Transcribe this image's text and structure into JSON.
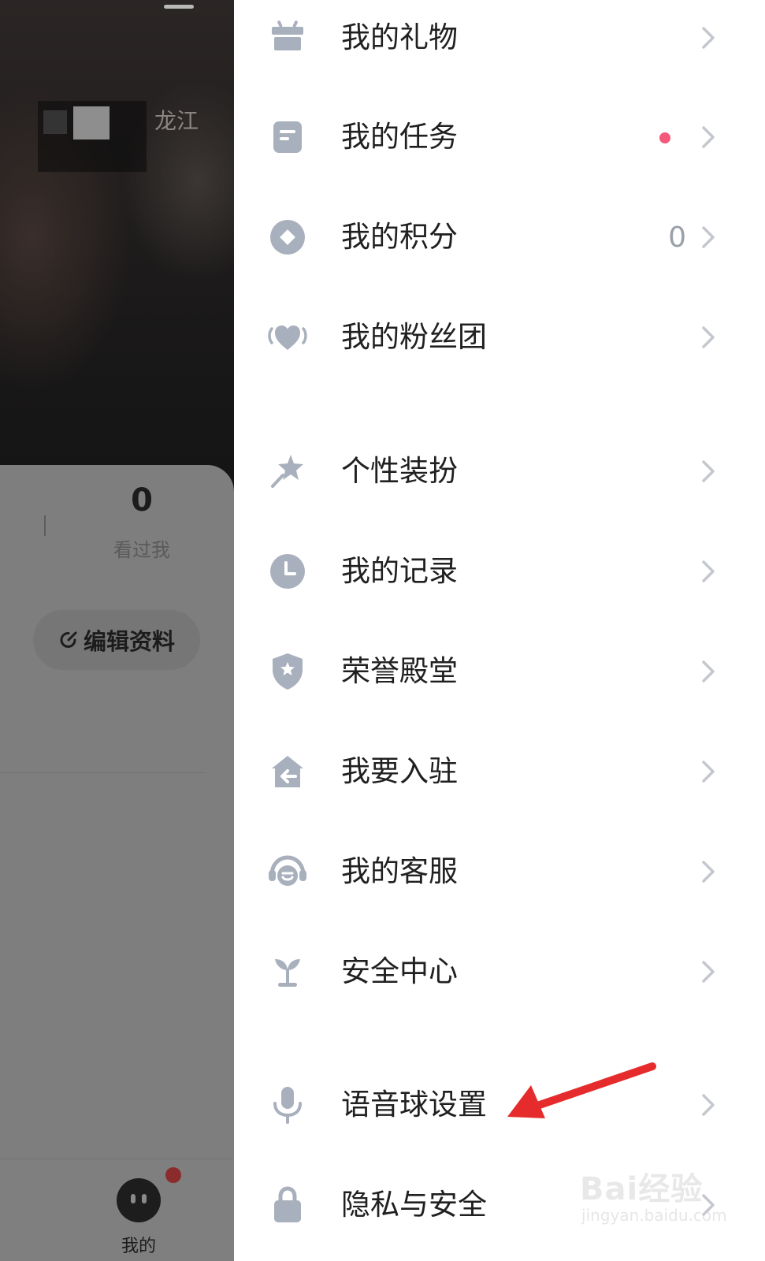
{
  "profile": {
    "name_visible_fragment": "龙江",
    "stat": {
      "count": "0",
      "label": "看过我"
    },
    "edit_profile_label": "编辑资料"
  },
  "bottom_nav": {
    "me_label": "我的"
  },
  "menu": {
    "items": [
      {
        "label": "我的礼物",
        "icon": "gift-icon"
      },
      {
        "label": "我的任务",
        "icon": "task-icon",
        "badge": "red-dot"
      },
      {
        "label": "我的积分",
        "icon": "points-icon",
        "value": "0"
      },
      {
        "label": "我的粉丝团",
        "icon": "fan-heart-icon"
      },
      {
        "label": "个性装扮",
        "icon": "magic-wand-icon"
      },
      {
        "label": "我的记录",
        "icon": "clock-icon"
      },
      {
        "label": "荣誉殿堂",
        "icon": "shield-star-icon"
      },
      {
        "label": "我要入驻",
        "icon": "house-enter-icon"
      },
      {
        "label": "我的客服",
        "icon": "headset-icon"
      },
      {
        "label": "安全中心",
        "icon": "sprout-icon"
      },
      {
        "label": "语音球设置",
        "icon": "microphone-icon"
      },
      {
        "label": "隐私与安全",
        "icon": "lock-icon"
      }
    ]
  },
  "colors": {
    "icon_gray": "#a9b0bd",
    "chevron": "#c4c8ce",
    "badge": "#f4587a",
    "annotation_arrow": "#e52b2b"
  },
  "watermark": {
    "brand": "Bai经验",
    "sub": "jingyan.baidu.com"
  }
}
